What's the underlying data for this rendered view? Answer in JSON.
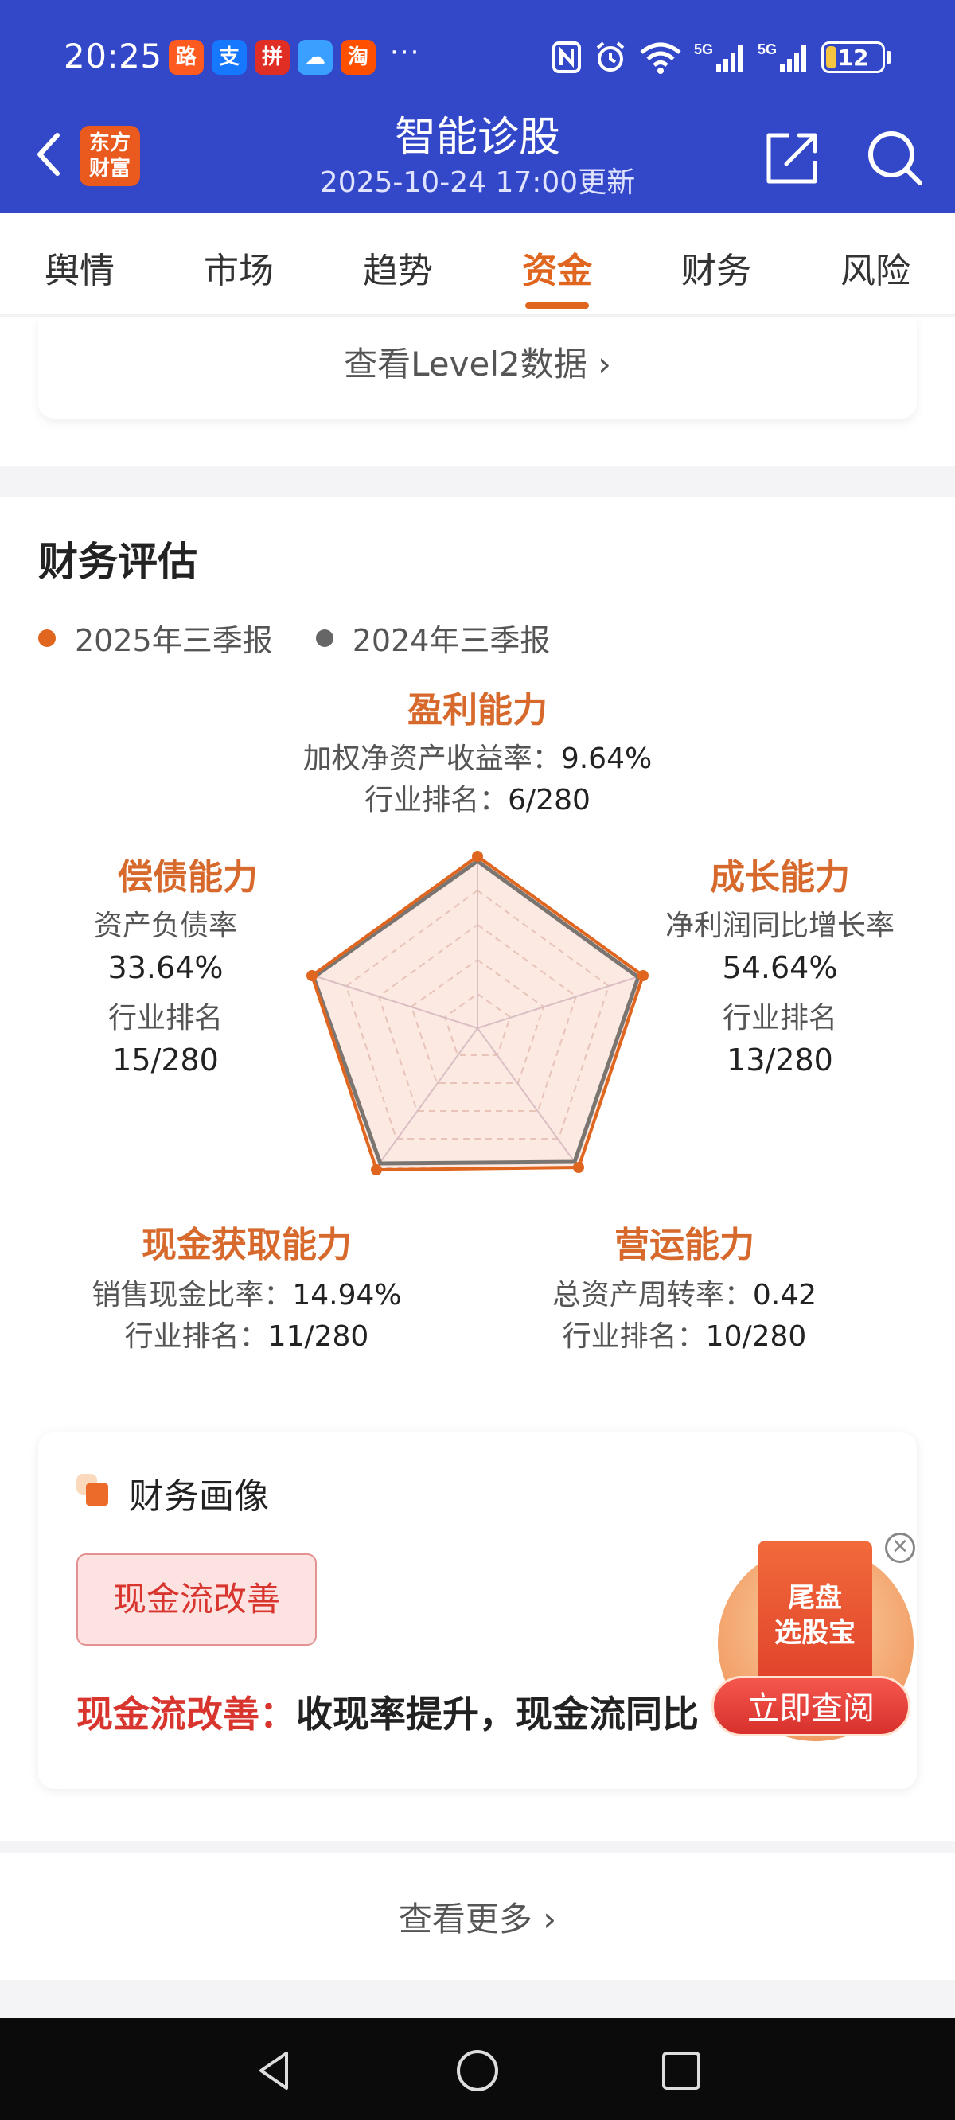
{
  "status_bar": {
    "time": "20:25",
    "apps": [
      {
        "icon": "meituan-icon",
        "glyph": "路",
        "color": "#ff5a1f"
      },
      {
        "icon": "alipay-icon",
        "glyph": "支",
        "color": "#1677ff"
      },
      {
        "icon": "pinduoduo-icon",
        "glyph": "拼",
        "color": "#e02e24"
      },
      {
        "icon": "weather-icon",
        "glyph": "☁",
        "color": "#3aa0ff"
      },
      {
        "icon": "taobao-icon",
        "glyph": "淘",
        "color": "#ff5000"
      }
    ],
    "more": "···",
    "battery": "12"
  },
  "header": {
    "logo_line1": "东方",
    "logo_line2": "财富",
    "title": "智能诊股",
    "subtitle": "2025-10-24 17:00更新"
  },
  "tabs": [
    "舆情",
    "市场",
    "趋势",
    "资金",
    "财务",
    "风险"
  ],
  "active_tab": "资金",
  "level2_link": "查看Level2数据 ›",
  "financial": {
    "title": "财务评估",
    "legend": [
      {
        "label": "2025年三季报",
        "color": "#e0661f"
      },
      {
        "label": "2024年三季报",
        "color": "#666666"
      }
    ],
    "profit": {
      "title": "盈利能力",
      "line1": "加权净资产收益率：",
      "value1": "9.64%",
      "line2": "行业排名：",
      "value2": "6/280"
    },
    "growth": {
      "title": "成长能力",
      "label": "净利润同比增长率",
      "value": "54.64%",
      "rank_label": "行业排名",
      "rank": "13/280"
    },
    "solvency": {
      "title": "偿债能力",
      "label": "资产负债率",
      "value": "33.64%",
      "rank_label": "行业排名",
      "rank": "15/280"
    },
    "cash": {
      "title": "现金获取能力",
      "line1": "销售现金比率：",
      "value1": "14.94%",
      "line2": "行业排名：",
      "value2": "11/280"
    },
    "operation": {
      "title": "营运能力",
      "line1": "总资产周转率：",
      "value1": "0.42",
      "line2": "行业排名：",
      "value2": "10/280"
    }
  },
  "portrait": {
    "title": "财务画像",
    "tag": "现金流改善",
    "desc_highlight": "现金流改善：",
    "desc_text": "收现率提升，现金流同比"
  },
  "ad": {
    "line1": "尾盘",
    "line2": "选股宝",
    "button": "立即查阅",
    "close": "✕"
  },
  "more_link": "查看更多 ›"
}
